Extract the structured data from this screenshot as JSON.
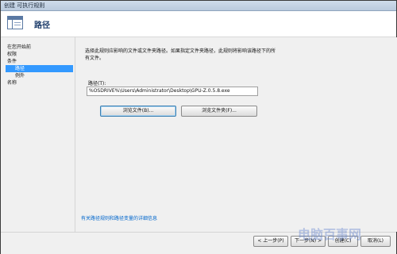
{
  "window": {
    "title": "创建 可执行规则"
  },
  "header": {
    "title": "路径",
    "icon": "rule-window-icon"
  },
  "sidebar": {
    "items": [
      {
        "label": "在您开始前",
        "selected": false,
        "indent": false
      },
      {
        "label": "权限",
        "selected": false,
        "indent": false
      },
      {
        "label": "条件",
        "selected": false,
        "indent": false
      },
      {
        "label": "路径",
        "selected": true,
        "indent": true
      },
      {
        "label": "例外",
        "selected": false,
        "indent": true
      },
      {
        "label": "名称",
        "selected": false,
        "indent": false
      }
    ]
  },
  "main": {
    "description_line1": "选择此规则应影响的文件或文件夹路径。如果指定文件夹路径，此规则将影响该路径下的所",
    "description_line2": "有文件。",
    "path_label": "路径(T):",
    "path_value": "%OSDRIVE%\\Users\\Administrator\\Desktop\\GPU-Z.0.5.8.exe",
    "browse_files_label": "浏览文件(B)...",
    "browse_folders_label": "浏览文件夹(F)...",
    "help_link": "有关路径规则和路径变量的详细信息"
  },
  "footer": {
    "back_label": "< 上一步(P)",
    "next_label": "下一步(N) >",
    "create_label": "创建(C)",
    "cancel_label": "取消(L)"
  },
  "colors": {
    "selection": "#3399ff",
    "header_title": "#1e3d6b",
    "link": "#0066cc"
  },
  "watermark": {
    "text": "电脑百事网"
  }
}
